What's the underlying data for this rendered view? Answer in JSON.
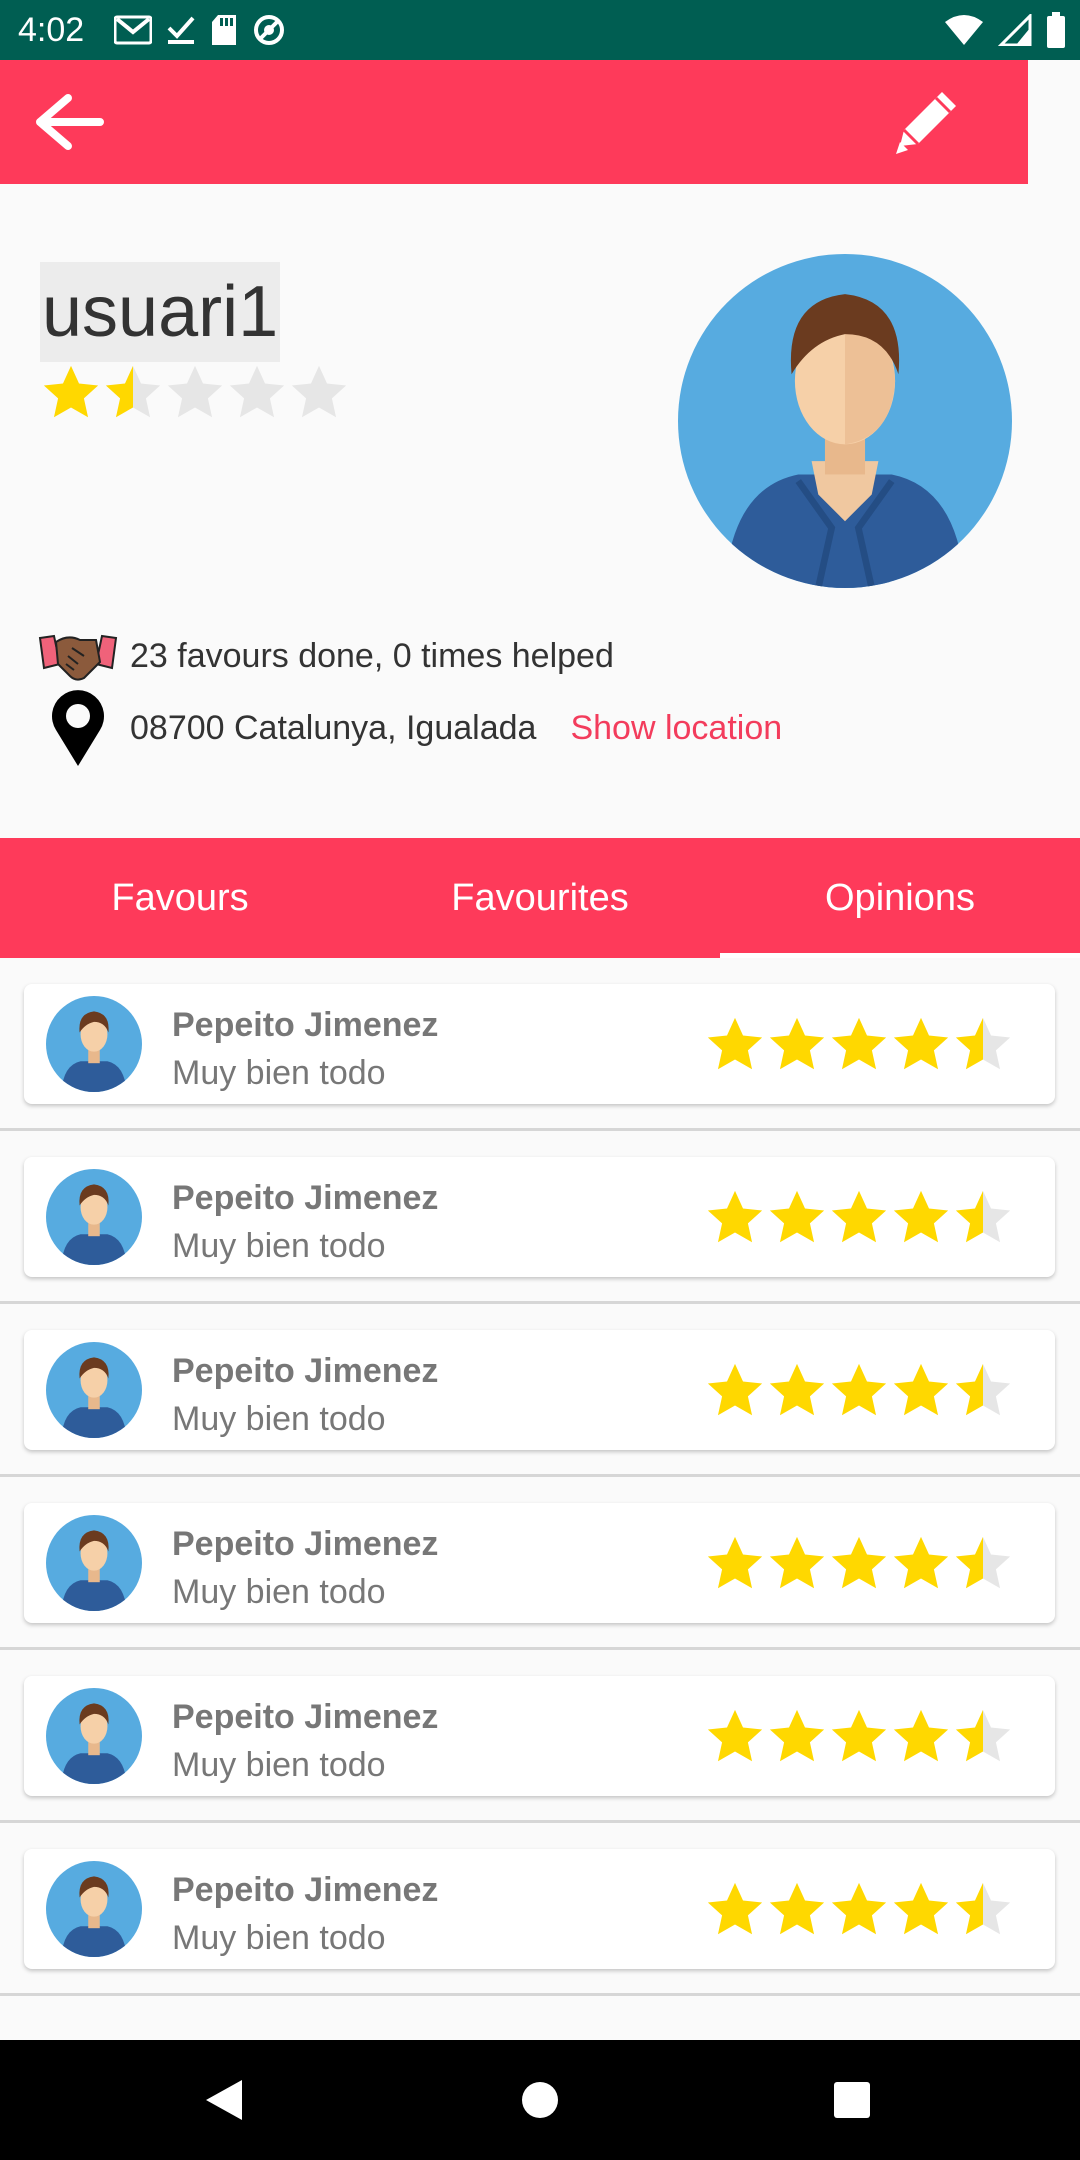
{
  "status_bar": {
    "time": "4:02",
    "colors": {
      "background": "#005e52"
    },
    "left_icons": [
      "gmail-icon",
      "checkmark-icon",
      "sd-card-icon",
      "sync-icon"
    ],
    "right_icons": [
      "wifi-icon",
      "signal-icon",
      "battery-icon"
    ]
  },
  "app_bar": {
    "color": "#fe3a5a",
    "back_icon": "arrow-back-icon",
    "edit_icon": "pencil-icon"
  },
  "profile": {
    "username": "usuari1",
    "rating": 1.5,
    "rating_max": 5,
    "favours_text": "23 favours done, 0 times helped",
    "location_text": "08700 Catalunya, Igualada",
    "show_location_label": "Show location"
  },
  "tabs": [
    {
      "label": "Favours",
      "active": false
    },
    {
      "label": "Favourites",
      "active": false
    },
    {
      "label": "Opinions",
      "active": true
    }
  ],
  "opinions": [
    {
      "name": "Pepeito Jimenez",
      "comment": "Muy bien todo",
      "rating": 4.5
    },
    {
      "name": "Pepeito Jimenez",
      "comment": "Muy bien todo",
      "rating": 4.5
    },
    {
      "name": "Pepeito Jimenez",
      "comment": "Muy bien todo",
      "rating": 4.5
    },
    {
      "name": "Pepeito Jimenez",
      "comment": "Muy bien todo",
      "rating": 4.5
    },
    {
      "name": "Pepeito Jimenez",
      "comment": "Muy bien todo",
      "rating": 4.5
    },
    {
      "name": "Pepeito Jimenez",
      "comment": "Muy bien todo",
      "rating": 4.5
    }
  ],
  "colors": {
    "accent": "#fe3a5a",
    "star_filled": "#ffd800",
    "star_empty": "#e6e6e6",
    "link": "#f33c5c"
  },
  "nav_bar": {
    "icons": [
      "back-triangle-icon",
      "home-circle-icon",
      "recents-square-icon"
    ]
  }
}
